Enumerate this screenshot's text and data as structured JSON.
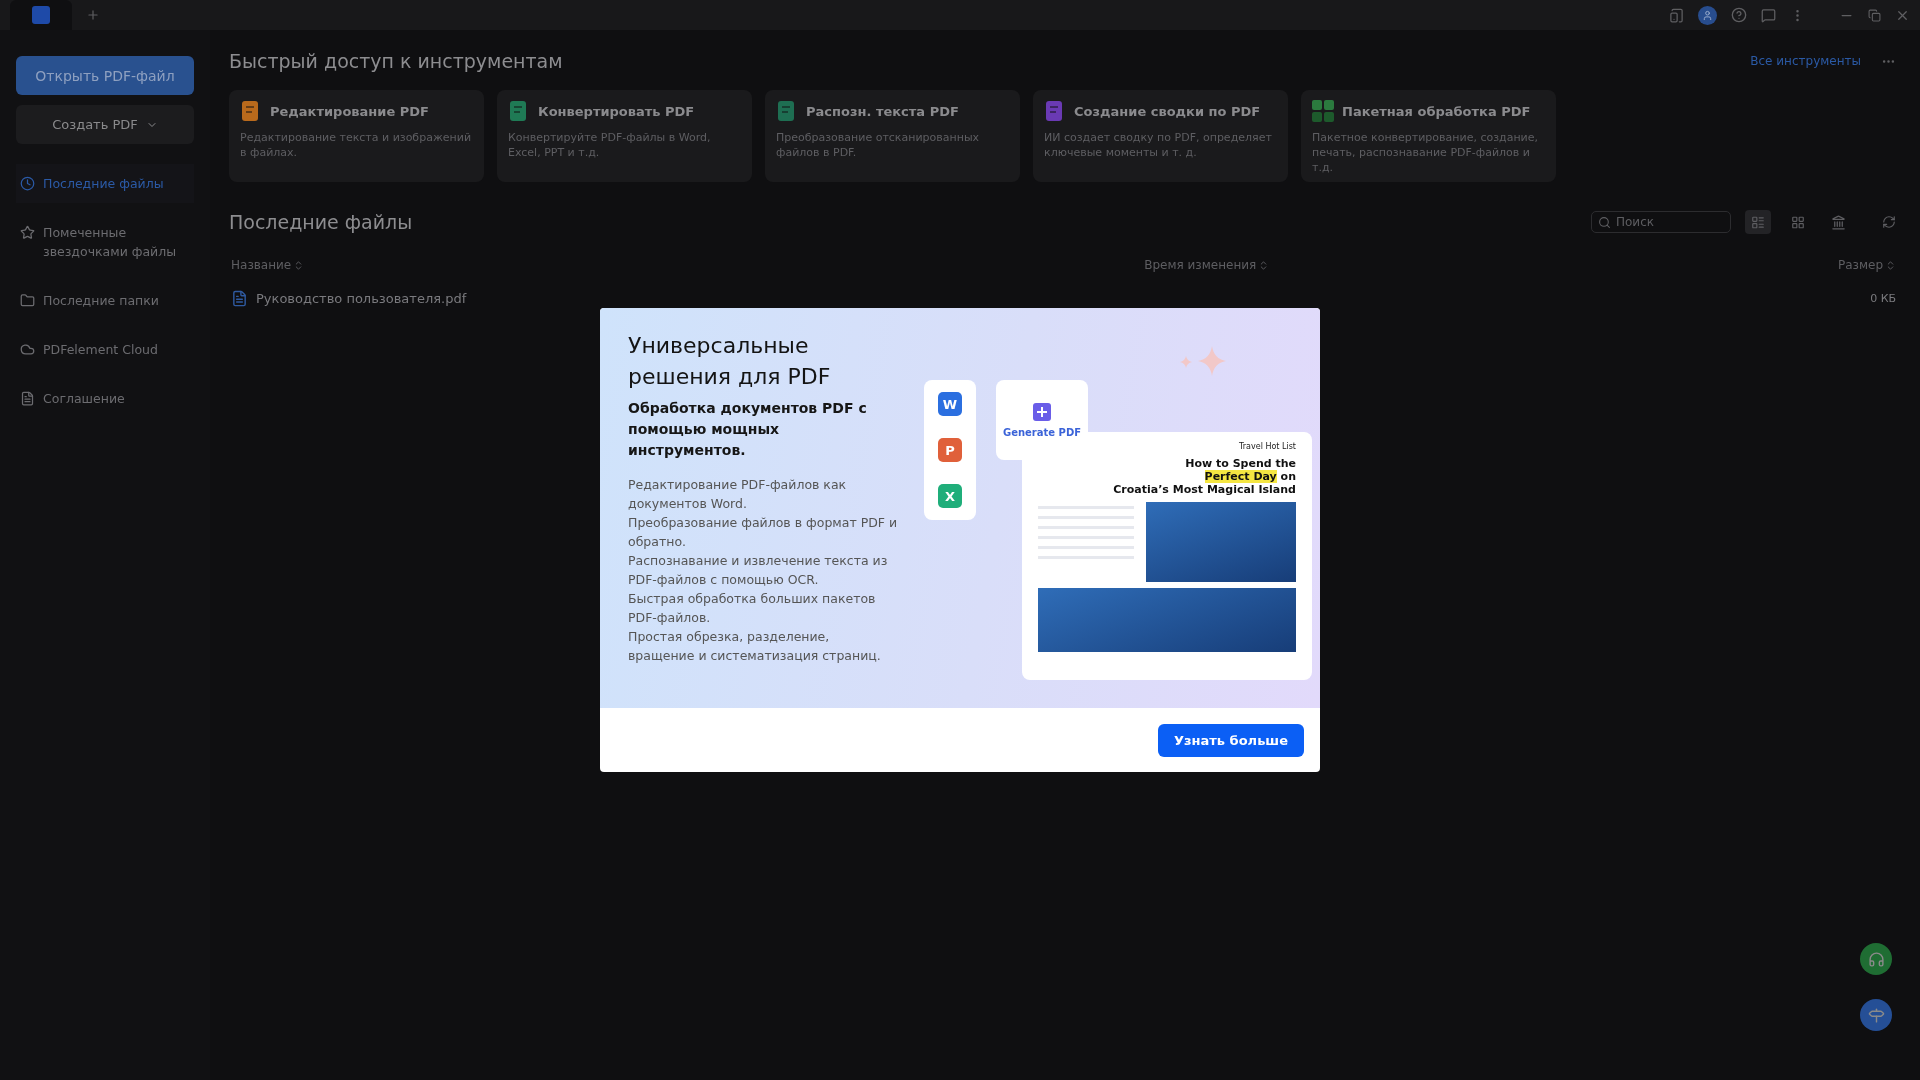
{
  "sidebar": {
    "open_button": "Открыть PDF-файл",
    "create_button": "Создать PDF",
    "items": [
      {
        "kind": "clock",
        "label": "Последние файлы",
        "selected": true
      },
      {
        "kind": "star",
        "label": "Помеченные звездочками файлы",
        "selected": false
      },
      {
        "kind": "folder",
        "label": "Последние папки",
        "selected": false
      },
      {
        "kind": "cloud",
        "label": "PDFelement Cloud",
        "selected": false
      },
      {
        "kind": "doc",
        "label": "Соглашение",
        "selected": false
      }
    ]
  },
  "quick_tools": {
    "title": "Быстрый доступ к инструментам",
    "all_link": "Все инструменты",
    "tools": [
      {
        "kind": "edit",
        "title": "Редактирование PDF",
        "description": "Редактирование текста и изображений в файлах."
      },
      {
        "kind": "convert",
        "title": "Конвертировать PDF",
        "description": "Конвертируйте PDF-файлы в Word, Excel, PPT и т.д."
      },
      {
        "kind": "ocr",
        "title": "Распозн. текста PDF",
        "description": "Преобразование отсканированных файлов в PDF."
      },
      {
        "kind": "summary",
        "title": "Создание сводки по PDF",
        "description": "ИИ создает сводку по PDF, определяет ключевые моменты и т. д."
      },
      {
        "kind": "batch",
        "title": "Пакетная обработка PDF",
        "description": "Пакетное конвертирование, создание, печать, распознавание PDF-файлов и т.д."
      }
    ]
  },
  "recent": {
    "title": "Последние файлы",
    "search": {
      "placeholder": "Поиск"
    },
    "view_modes": [
      {
        "kind": "list",
        "selected": true
      },
      {
        "kind": "grid",
        "selected": false
      }
    ],
    "columns": [
      "Название",
      "Время изменения",
      "Размер"
    ],
    "rows": [
      {
        "name": "Руководство пользователя.pdf",
        "size": "0 КБ"
      }
    ]
  },
  "modal": {
    "title": "Универсальные решения для PDF",
    "subtitle": "Обработка документов PDF с помощью мощных инструментов.",
    "features": [
      "Редактирование PDF-файлов как документов Word.",
      "Преобразование файлов в формат PDF и обратно.",
      "Распознавание и извлечение текста из PDF-файлов с помощью OCR.",
      "Быстрая обработка больших пакетов PDF-файлов.",
      "Простая обрезка, разделение, вращение и систематизация страниц."
    ],
    "illustration": {
      "apps": [
        {
          "letter": "W",
          "color": "#2b6fe0"
        },
        {
          "letter": "P",
          "color": "#e0603a"
        },
        {
          "letter": "X",
          "color": "#1fae7a"
        }
      ],
      "generate_label": "Generate PDF",
      "doc_tag": "Travel Hot List",
      "headline_1": "How to Spend the",
      "headline_highlight": "Perfect Day",
      "headline_2": "on",
      "headline_3": "Croatia’s Most Magical Island"
    },
    "button": "Узнать больше"
  }
}
